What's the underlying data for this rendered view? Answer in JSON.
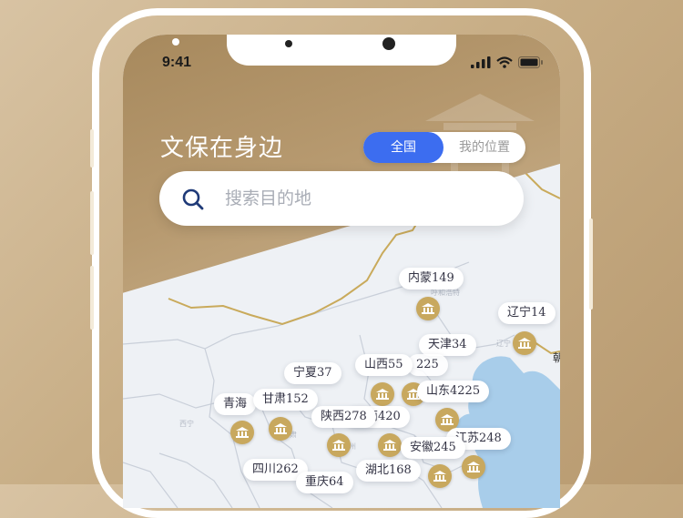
{
  "status": {
    "time": "9:41"
  },
  "header": {
    "title": "文保在身边"
  },
  "toggle": {
    "national": "全国",
    "my_location": "我的位置"
  },
  "search": {
    "placeholder": "搜索目的地"
  },
  "map": {
    "regions": [
      {
        "label": "内蒙149"
      },
      {
        "label": "辽宁14"
      },
      {
        "label": "天津34"
      },
      {
        "label": "山西55"
      },
      {
        "label": "225"
      },
      {
        "label": "宁夏37"
      },
      {
        "label": "山东4225"
      },
      {
        "label": "青海"
      },
      {
        "label": "甘肃152"
      },
      {
        "label": "陕西278"
      },
      {
        "label": "河南420"
      },
      {
        "label": "江苏248"
      },
      {
        "label": "安徽245"
      },
      {
        "label": "四川262"
      },
      {
        "label": "湖北168"
      },
      {
        "label": "重庆64"
      }
    ],
    "edge_label": "朝"
  },
  "colors": {
    "accent": "#3c6df0",
    "marker": "#c8a85e",
    "banner": "#b79a70",
    "sea": "#a8cdea"
  },
  "icons": [
    "search-icon",
    "signal-icon",
    "wifi-icon",
    "battery-icon",
    "heritage-marker-icon"
  ]
}
